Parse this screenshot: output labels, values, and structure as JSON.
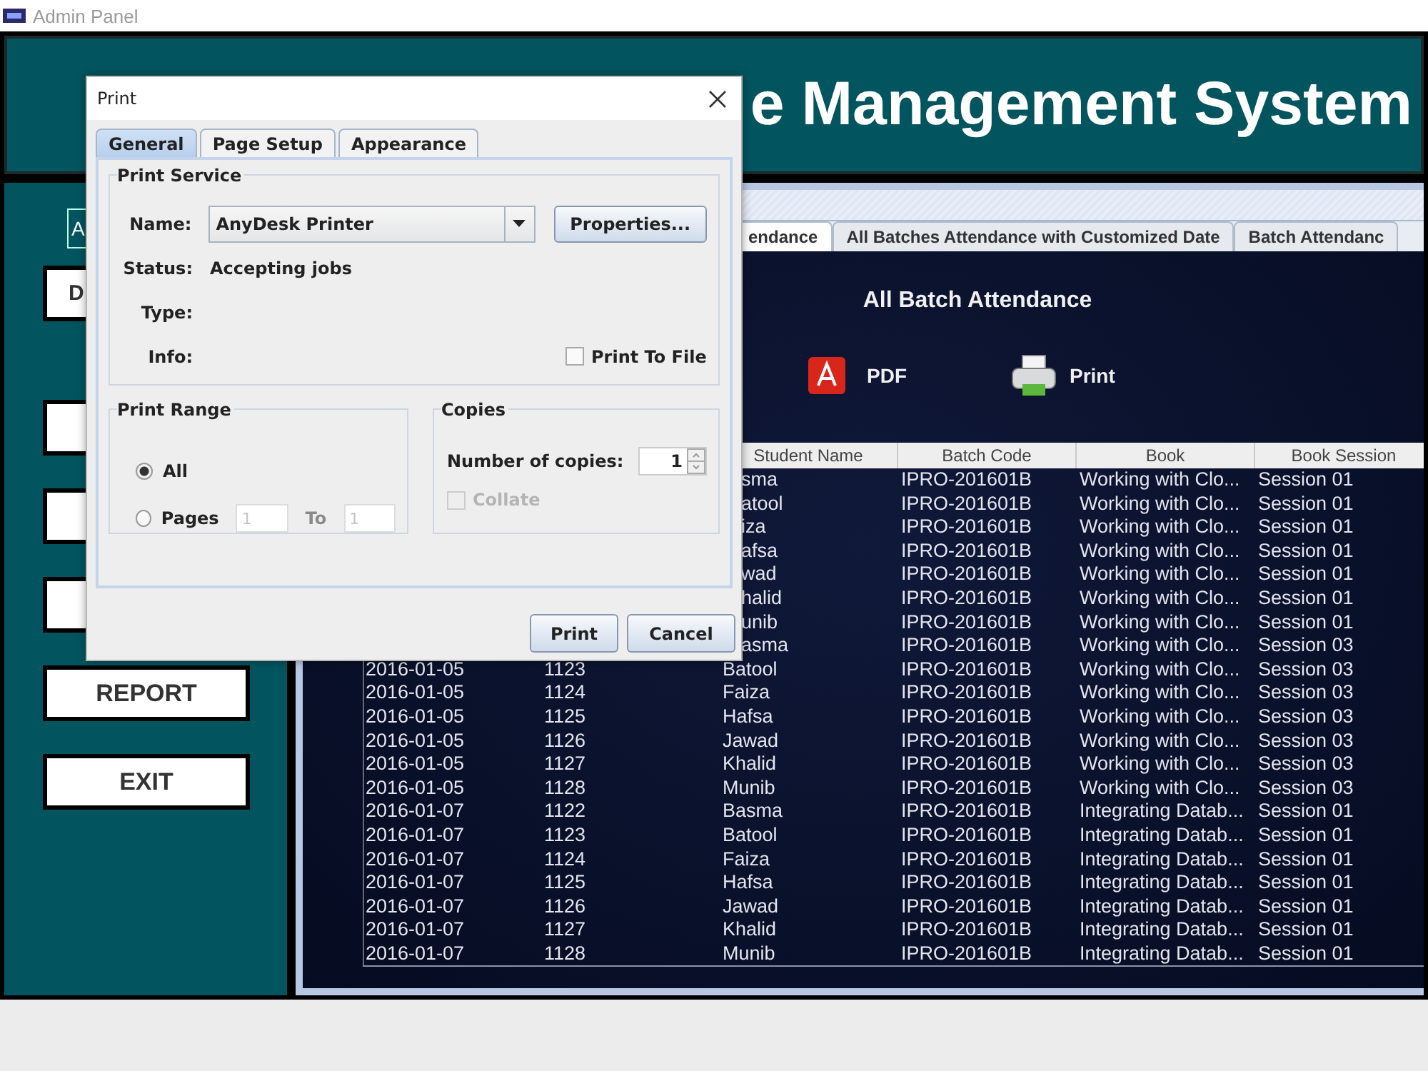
{
  "window": {
    "title": "Admin Panel"
  },
  "header": {
    "title": "e Management System"
  },
  "sidebar": {
    "label": "A",
    "buttons": [
      {
        "kind": "labeled",
        "label": "D"
      },
      {
        "kind": "covered"
      },
      {
        "kind": "covered"
      },
      {
        "kind": "covered"
      },
      {
        "kind": "labeled",
        "label": "REPORT"
      },
      {
        "kind": "labeled",
        "label": "EXIT"
      }
    ]
  },
  "tabs": [
    {
      "label": "endance",
      "selected": true
    },
    {
      "label": "All Batches Attendance with Customized Date",
      "selected": false
    },
    {
      "label": "Batch Attendanc",
      "selected": false
    }
  ],
  "panel": {
    "title": "All Batch Attendance",
    "actions": [
      {
        "kind": "pdf",
        "label": "PDF"
      },
      {
        "kind": "print",
        "label": "Print"
      }
    ]
  },
  "table": {
    "columns": [
      "Student Name",
      "Batch Code",
      "Book",
      "Book Session"
    ],
    "rows": [
      {
        "student": "sma",
        "batch": "IPRO-201601B",
        "book": "Working with Clo...",
        "session": "Session 01"
      },
      {
        "student": "atool",
        "batch": "IPRO-201601B",
        "book": "Working with Clo...",
        "session": "Session 01"
      },
      {
        "student": "iza",
        "batch": "IPRO-201601B",
        "book": "Working with Clo...",
        "session": "Session 01"
      },
      {
        "student": "afsa",
        "batch": "IPRO-201601B",
        "book": "Working with Clo...",
        "session": "Session 01"
      },
      {
        "student": "wad",
        "batch": "IPRO-201601B",
        "book": "Working with Clo...",
        "session": "Session 01"
      },
      {
        "student": "halid",
        "batch": "IPRO-201601B",
        "book": "Working with Clo...",
        "session": "Session 01"
      },
      {
        "student": "unib",
        "batch": "IPRO-201601B",
        "book": "Working with Clo...",
        "session": "Session 01"
      },
      {
        "student": "asma",
        "batch": "IPRO-201601B",
        "book": "Working with Clo...",
        "session": "Session 03"
      },
      {
        "date": "2016-01-05",
        "id": "1123",
        "student": "Batool",
        "batch": "IPRO-201601B",
        "book": "Working with Clo...",
        "session": "Session 03"
      },
      {
        "date": "2016-01-05",
        "id": "1124",
        "student": "Faiza",
        "batch": "IPRO-201601B",
        "book": "Working with Clo...",
        "session": "Session 03"
      },
      {
        "date": "2016-01-05",
        "id": "1125",
        "student": "Hafsa",
        "batch": "IPRO-201601B",
        "book": "Working with Clo...",
        "session": "Session 03"
      },
      {
        "date": "2016-01-05",
        "id": "1126",
        "student": "Jawad",
        "batch": "IPRO-201601B",
        "book": "Working with Clo...",
        "session": "Session 03"
      },
      {
        "date": "2016-01-05",
        "id": "1127",
        "student": "Khalid",
        "batch": "IPRO-201601B",
        "book": "Working with Clo...",
        "session": "Session 03"
      },
      {
        "date": "2016-01-05",
        "id": "1128",
        "student": "Munib",
        "batch": "IPRO-201601B",
        "book": "Working with Clo...",
        "session": "Session 03"
      },
      {
        "date": "2016-01-07",
        "id": "1122",
        "student": "Basma",
        "batch": "IPRO-201601B",
        "book": "Integrating Datab...",
        "session": "Session 01"
      },
      {
        "date": "2016-01-07",
        "id": "1123",
        "student": "Batool",
        "batch": "IPRO-201601B",
        "book": "Integrating Datab...",
        "session": "Session 01"
      },
      {
        "date": "2016-01-07",
        "id": "1124",
        "student": "Faiza",
        "batch": "IPRO-201601B",
        "book": "Integrating Datab...",
        "session": "Session 01"
      },
      {
        "date": "2016-01-07",
        "id": "1125",
        "student": "Hafsa",
        "batch": "IPRO-201601B",
        "book": "Integrating Datab...",
        "session": "Session 01"
      },
      {
        "date": "2016-01-07",
        "id": "1126",
        "student": "Jawad",
        "batch": "IPRO-201601B",
        "book": "Integrating Datab...",
        "session": "Session 01"
      },
      {
        "date": "2016-01-07",
        "id": "1127",
        "student": "Khalid",
        "batch": "IPRO-201601B",
        "book": "Integrating Datab...",
        "session": "Session 01"
      },
      {
        "date": "2016-01-07",
        "id": "1128",
        "student": "Munib",
        "batch": "IPRO-201601B",
        "book": "Integrating Datab...",
        "session": "Session 01"
      }
    ]
  },
  "dialog": {
    "title": "Print",
    "tabs": [
      {
        "label": "General",
        "selected": true
      },
      {
        "label": "Page Setup",
        "selected": false
      },
      {
        "label": "Appearance",
        "selected": false
      }
    ],
    "print_service": {
      "title": "Print Service",
      "name_label": "Name:",
      "printer": "AnyDesk Printer",
      "properties_button": "Properties...",
      "status_label": "Status:",
      "status": "Accepting jobs",
      "type_label": "Type:",
      "info_label": "Info:",
      "print_to_file": {
        "label": "Print To File",
        "checked": false
      }
    },
    "print_range": {
      "title": "Print Range",
      "options": [
        {
          "label": "All",
          "selected": true
        },
        {
          "label": "Pages",
          "selected": false
        }
      ],
      "from": "1",
      "to_label": "To",
      "to": "1",
      "fields_disabled": true
    },
    "copies": {
      "title": "Copies",
      "label": "Number of copies:",
      "value": "1",
      "collate": {
        "label": "Collate",
        "checked": false,
        "disabled": true
      }
    },
    "buttons": [
      "Print",
      "Cancel"
    ]
  }
}
